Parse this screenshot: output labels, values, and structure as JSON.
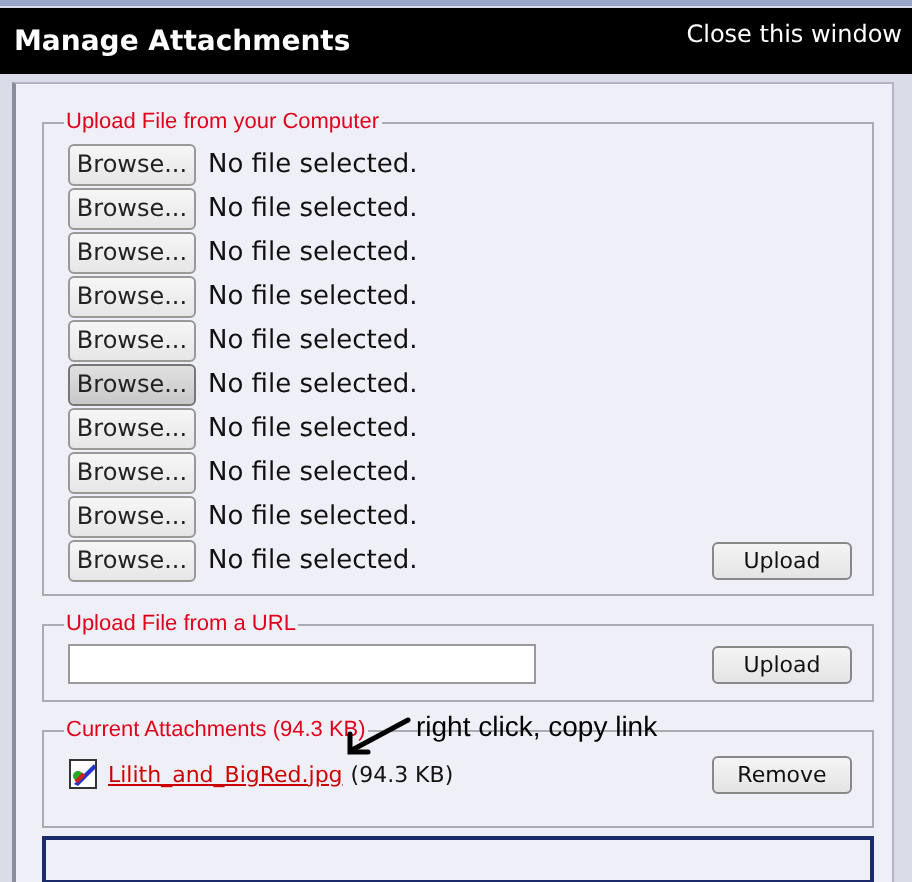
{
  "window": {
    "title": "Manage Attachments",
    "close_link": "Close this window"
  },
  "upload_computer": {
    "legend": "Upload File from your Computer",
    "rows": [
      {
        "button": "Browse...",
        "status": "No file selected.",
        "hovered": false
      },
      {
        "button": "Browse...",
        "status": "No file selected.",
        "hovered": false
      },
      {
        "button": "Browse...",
        "status": "No file selected.",
        "hovered": false
      },
      {
        "button": "Browse...",
        "status": "No file selected.",
        "hovered": false
      },
      {
        "button": "Browse...",
        "status": "No file selected.",
        "hovered": false
      },
      {
        "button": "Browse...",
        "status": "No file selected.",
        "hovered": true
      },
      {
        "button": "Browse...",
        "status": "No file selected.",
        "hovered": false
      },
      {
        "button": "Browse...",
        "status": "No file selected.",
        "hovered": false
      },
      {
        "button": "Browse...",
        "status": "No file selected.",
        "hovered": false
      },
      {
        "button": "Browse...",
        "status": "No file selected.",
        "hovered": false
      }
    ],
    "upload_button": "Upload"
  },
  "upload_url": {
    "legend": "Upload File from a URL",
    "upload_button": "Upload"
  },
  "current_attachments": {
    "legend": "Current Attachments (94.3 KB)",
    "files": [
      {
        "name": "Lilith_and_BigRed.jpg",
        "size": "(94.3 KB)",
        "remove_button": "Remove"
      }
    ]
  },
  "annotation": {
    "text": "right click, copy link"
  }
}
